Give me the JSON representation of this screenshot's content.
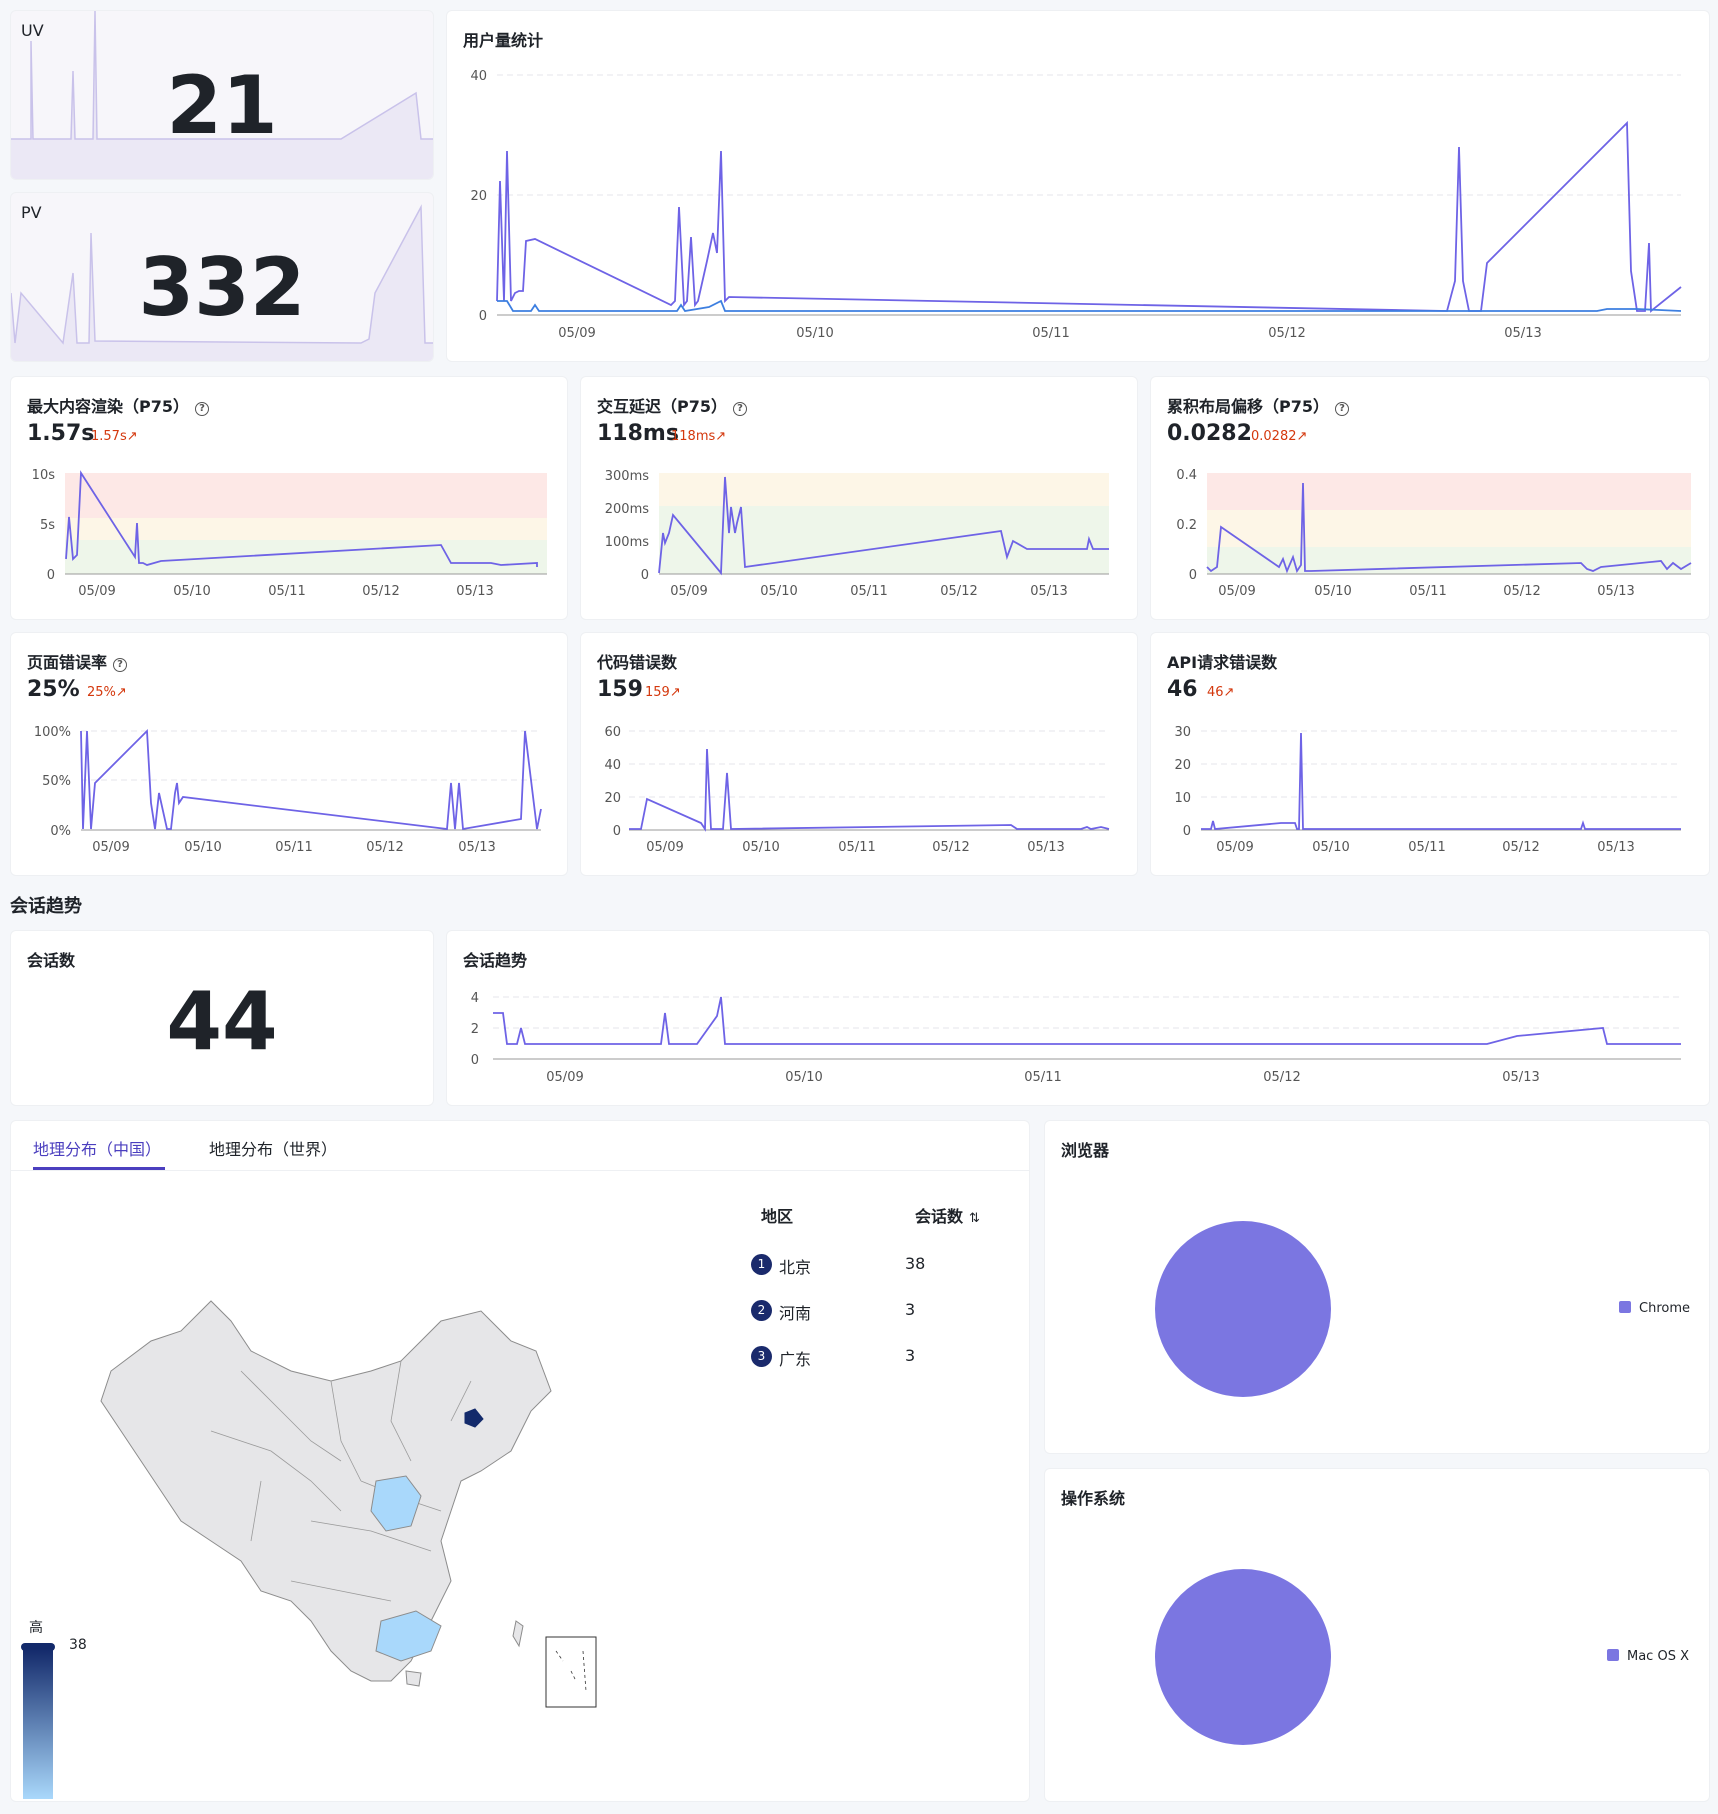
{
  "uv": {
    "label": "UV",
    "value": "21"
  },
  "pv": {
    "label": "PV",
    "value": "332"
  },
  "user_stats": {
    "title": "用户量统计"
  },
  "metrics": [
    {
      "title": "最大内容渲染（P75）",
      "value": "1.57s",
      "delta": "1.57s",
      "help": true
    },
    {
      "title": "交互延迟（P75）",
      "value": "118ms",
      "delta": "118ms",
      "help": true
    },
    {
      "title": "累积布局偏移（P75）",
      "value": "0.0282",
      "delta": "0.0282",
      "help": true
    },
    {
      "title": "页面错误率",
      "value": "25%",
      "delta": "25%",
      "help": true
    },
    {
      "title": "代码错误数",
      "value": "159",
      "delta": "159",
      "help": false
    },
    {
      "title": "API请求错误数",
      "value": "46",
      "delta": "46",
      "help": false
    }
  ],
  "session_section": {
    "title": "会话趋势"
  },
  "sessions": {
    "label": "会话数",
    "value": "44"
  },
  "session_trend": {
    "title": "会话趋势"
  },
  "geo": {
    "tabs": [
      {
        "label": "地理分布（中国）",
        "active": true
      },
      {
        "label": "地理分布（世界）",
        "active": false
      }
    ],
    "table_headers": {
      "region": "地区",
      "count": "会话数",
      "sort_icon": "sort-icon"
    },
    "rows": [
      {
        "rank": "1",
        "region": "北京",
        "count": "38"
      },
      {
        "rank": "2",
        "region": "河南",
        "count": "3"
      },
      {
        "rank": "3",
        "region": "广东",
        "count": "3"
      }
    ],
    "scale": {
      "high_label": "高",
      "max": "38"
    }
  },
  "browser": {
    "title": "浏览器",
    "legend": "Chrome"
  },
  "os": {
    "title": "操作系统",
    "legend": "Mac OS X"
  },
  "colors": {
    "line_primary": "#6e63e6",
    "line_secondary": "#3d7fe0",
    "pie": "#7b76e1",
    "accent": "#4b3fbf",
    "delta": "#d4380d"
  },
  "chart_data": [
    {
      "type": "area",
      "name": "UV sparkline",
      "values": [
        0,
        0,
        1,
        18,
        0,
        0,
        22,
        0,
        0,
        0,
        0,
        0,
        0,
        0,
        0,
        6,
        0
      ],
      "title": ""
    },
    {
      "type": "area",
      "name": "PV sparkline",
      "values": [
        12,
        10,
        8,
        6,
        2,
        1,
        10,
        12,
        8,
        1,
        1,
        1,
        1,
        1,
        1,
        1,
        2,
        12,
        20
      ],
      "title": ""
    },
    {
      "type": "line",
      "title": "用户量统计",
      "x_ticks": [
        "05/09",
        "05/10",
        "05/11",
        "05/12",
        "05/13"
      ],
      "y_ticks": [
        0,
        20,
        40
      ],
      "ylim": [
        0,
        40
      ]
    },
    {
      "type": "line",
      "title": "最大内容渲染（P75）",
      "x_ticks": [
        "05/09",
        "05/10",
        "05/11",
        "05/12",
        "05/13"
      ],
      "y_ticks": [
        "0",
        "5s",
        "10s"
      ],
      "ylim": [
        0,
        10
      ]
    },
    {
      "type": "line",
      "title": "交互延迟（P75）",
      "x_ticks": [
        "05/09",
        "05/10",
        "05/11",
        "05/12",
        "05/13"
      ],
      "y_ticks": [
        "0",
        "100ms",
        "200ms",
        "300ms"
      ],
      "ylim": [
        0,
        300
      ]
    },
    {
      "type": "line",
      "title": "累积布局偏移（P75）",
      "x_ticks": [
        "05/09",
        "05/10",
        "05/11",
        "05/12",
        "05/13"
      ],
      "y_ticks": [
        "0",
        "0.2",
        "0.4"
      ],
      "ylim": [
        0,
        0.4
      ]
    },
    {
      "type": "line",
      "title": "页面错误率",
      "x_ticks": [
        "05/09",
        "05/10",
        "05/11",
        "05/12",
        "05/13"
      ],
      "y_ticks": [
        "0%",
        "50%",
        "100%"
      ],
      "ylim": [
        0,
        100
      ]
    },
    {
      "type": "line",
      "title": "代码错误数",
      "x_ticks": [
        "05/09",
        "05/10",
        "05/11",
        "05/12",
        "05/13"
      ],
      "y_ticks": [
        "0",
        "20",
        "40",
        "60"
      ],
      "ylim": [
        0,
        60
      ]
    },
    {
      "type": "line",
      "title": "API请求错误数",
      "x_ticks": [
        "05/09",
        "05/10",
        "05/11",
        "05/12",
        "05/13"
      ],
      "y_ticks": [
        "0",
        "10",
        "20",
        "30"
      ],
      "ylim": [
        0,
        30
      ]
    },
    {
      "type": "line",
      "title": "会话趋势",
      "x_ticks": [
        "05/09",
        "05/10",
        "05/11",
        "05/12",
        "05/13"
      ],
      "y_ticks": [
        "0",
        "2",
        "4"
      ],
      "ylim": [
        0,
        4
      ]
    },
    {
      "type": "pie",
      "title": "浏览器",
      "categories": [
        "Chrome"
      ],
      "values": [
        100
      ]
    },
    {
      "type": "pie",
      "title": "操作系统",
      "categories": [
        "Mac OS X"
      ],
      "values": [
        100
      ]
    }
  ]
}
